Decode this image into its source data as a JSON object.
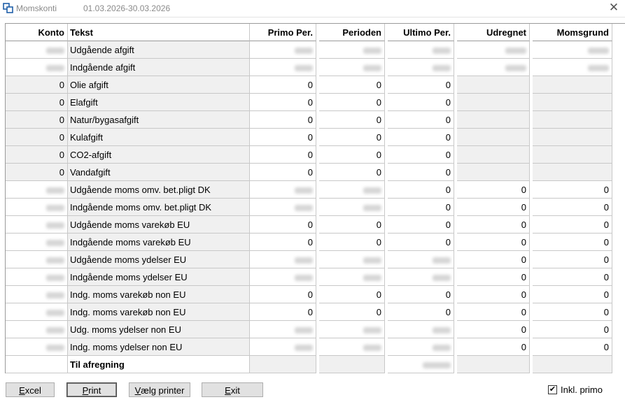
{
  "window": {
    "title": "Momskonti",
    "period": "01.03.2026-30.03.2026",
    "close_glyph": "✕"
  },
  "columns": [
    "Konto",
    "Tekst",
    "Primo Per.",
    "Perioden",
    "Ultimo Per.",
    "Udregnet",
    "Momsgrund"
  ],
  "rows": [
    {
      "konto": null,
      "tekst": "Udgående afgift",
      "primo": null,
      "perioden": null,
      "ultimo": null,
      "udregnet": null,
      "momsgrund": null
    },
    {
      "konto": null,
      "tekst": "Indgående afgift",
      "primo": null,
      "perioden": null,
      "ultimo": null,
      "udregnet": null,
      "momsgrund": null
    },
    {
      "konto": "0",
      "tekst": "Olie afgift",
      "primo": "0",
      "perioden": "0",
      "ultimo": "0",
      "udregnet": "",
      "momsgrund": ""
    },
    {
      "konto": "0",
      "tekst": "Elafgift",
      "primo": "0",
      "perioden": "0",
      "ultimo": "0",
      "udregnet": "",
      "momsgrund": ""
    },
    {
      "konto": "0",
      "tekst": "Natur/bygasafgift",
      "primo": "0",
      "perioden": "0",
      "ultimo": "0",
      "udregnet": "",
      "momsgrund": ""
    },
    {
      "konto": "0",
      "tekst": "Kulafgift",
      "primo": "0",
      "perioden": "0",
      "ultimo": "0",
      "udregnet": "",
      "momsgrund": ""
    },
    {
      "konto": "0",
      "tekst": "CO2-afgift",
      "primo": "0",
      "perioden": "0",
      "ultimo": "0",
      "udregnet": "",
      "momsgrund": ""
    },
    {
      "konto": "0",
      "tekst": "Vandafgift",
      "primo": "0",
      "perioden": "0",
      "ultimo": "0",
      "udregnet": "",
      "momsgrund": ""
    },
    {
      "konto": null,
      "tekst": "Udgående moms omv. bet.pligt DK",
      "primo": null,
      "perioden": null,
      "ultimo": "0",
      "udregnet": "0",
      "momsgrund": "0"
    },
    {
      "konto": null,
      "tekst": "Indgående moms omv. bet.pligt DK",
      "primo": null,
      "perioden": null,
      "ultimo": "0",
      "udregnet": "0",
      "momsgrund": "0"
    },
    {
      "konto": null,
      "tekst": "Udgående moms varekøb EU",
      "primo": "0",
      "perioden": "0",
      "ultimo": "0",
      "udregnet": "0",
      "momsgrund": "0"
    },
    {
      "konto": null,
      "tekst": "Indgående moms varekøb EU",
      "primo": "0",
      "perioden": "0",
      "ultimo": "0",
      "udregnet": "0",
      "momsgrund": "0"
    },
    {
      "konto": null,
      "tekst": "Udgående moms ydelser EU",
      "primo": null,
      "perioden": null,
      "ultimo": null,
      "udregnet": "0",
      "momsgrund": "0"
    },
    {
      "konto": null,
      "tekst": "Indgående moms ydelser EU",
      "primo": null,
      "perioden": null,
      "ultimo": null,
      "udregnet": "0",
      "momsgrund": "0"
    },
    {
      "konto": null,
      "tekst": "Indg. moms varekøb non EU",
      "primo": "0",
      "perioden": "0",
      "ultimo": "0",
      "udregnet": "0",
      "momsgrund": "0"
    },
    {
      "konto": null,
      "tekst": "Indg. moms varekøb non EU",
      "primo": "0",
      "perioden": "0",
      "ultimo": "0",
      "udregnet": "0",
      "momsgrund": "0"
    },
    {
      "konto": null,
      "tekst": "Udg. moms ydelser non EU",
      "primo": null,
      "perioden": null,
      "ultimo": null,
      "udregnet": "0",
      "momsgrund": "0"
    },
    {
      "konto": null,
      "tekst": "Indg. moms ydelser non EU",
      "primo": null,
      "perioden": null,
      "ultimo": null,
      "udregnet": "0",
      "momsgrund": "0"
    }
  ],
  "footer_row": {
    "tekst": "Til afregning"
  },
  "buttons": {
    "excel": {
      "pre": "",
      "u": "E",
      "post": "xcel"
    },
    "print": {
      "pre": "",
      "u": "P",
      "post": "rint"
    },
    "printer": {
      "pre": "",
      "u": "V",
      "post": "ælg printer"
    },
    "exit": {
      "pre": "",
      "u": "E",
      "post": "xit"
    }
  },
  "checkbox": {
    "label": "Inkl. primo",
    "checked": true,
    "mark": "✔"
  }
}
